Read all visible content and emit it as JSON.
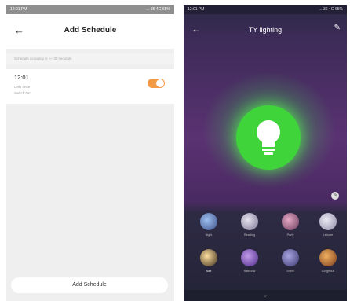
{
  "left_screen": {
    "status": {
      "time": "12:01 PM",
      "right": "... 36 4G 65%"
    },
    "title": "Add Schedule",
    "note": "Schedule accuracy is +/- 30 seconds",
    "schedule_item": {
      "time": "12:01",
      "line1": "Only once",
      "line2": "Switch:On",
      "enabled": true
    },
    "add_button_label": "Add Schedule",
    "colors": {
      "toggle": "#f39a44"
    }
  },
  "right_screen": {
    "status": {
      "time": "12:01 PM",
      "right": "... 36 4G 65%"
    },
    "title": "TY lighting",
    "bulb_color": "#3fd43a",
    "scenes": [
      {
        "label": "Night",
        "color": "#7aa0d8"
      },
      {
        "label": "Reading",
        "color": "#b6b0c8"
      },
      {
        "label": "Party",
        "color": "#a66b8a"
      },
      {
        "label": "Leisure",
        "color": "#c9c6d8"
      },
      {
        "label": "Soft",
        "color": "#d6a24a",
        "selected": true
      },
      {
        "label": "Rainbow",
        "color": "#8d5cc0"
      },
      {
        "label": "Shine",
        "color": "#6d6aa8"
      },
      {
        "label": "Gorgeous",
        "color": "#d2893f"
      }
    ]
  }
}
